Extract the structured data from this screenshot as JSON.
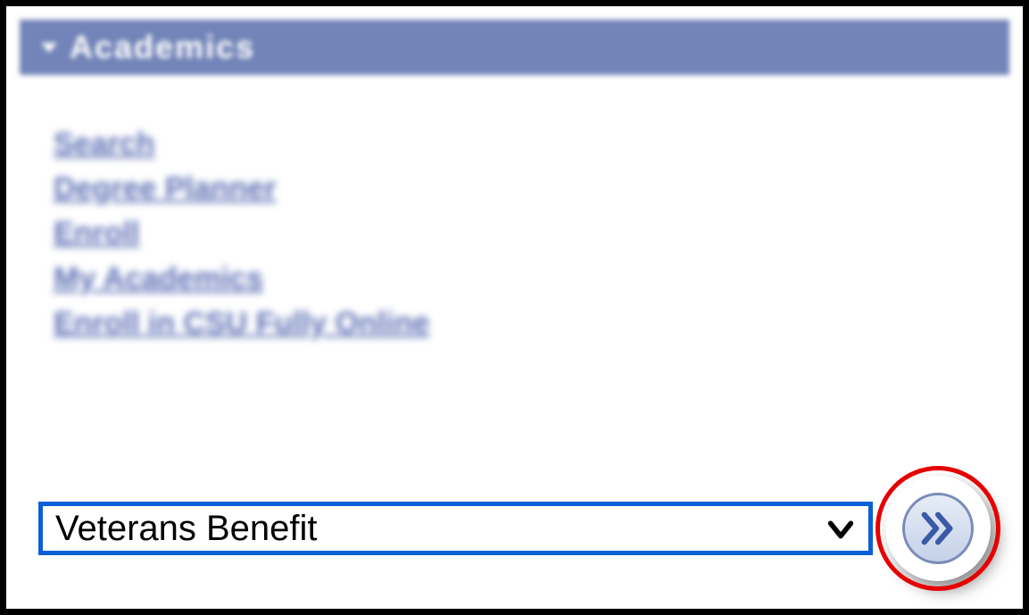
{
  "section": {
    "title": "Academics"
  },
  "links": {
    "search": "Search",
    "degree_planner": "Degree Planner",
    "enroll": "Enroll",
    "my_academics": "My Academics",
    "enroll_csu_online": "Enroll in CSU Fully Online"
  },
  "dropdown": {
    "selected": "Veterans Benefit"
  }
}
